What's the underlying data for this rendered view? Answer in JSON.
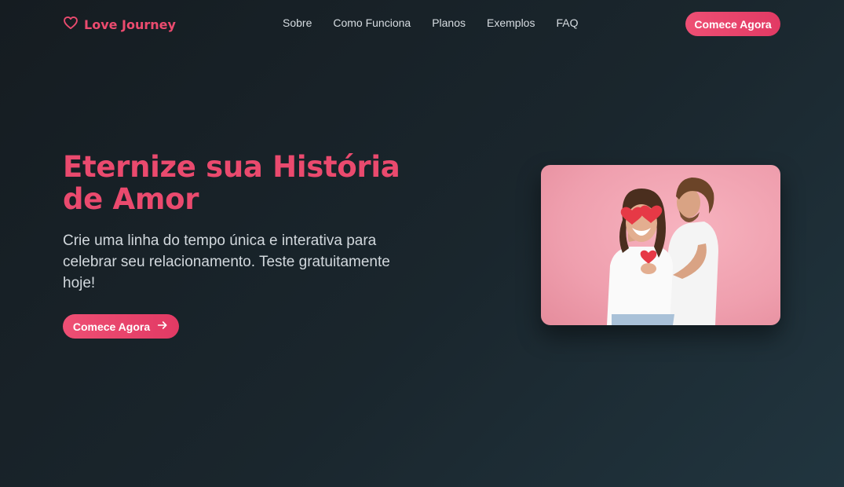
{
  "brand": {
    "name": "Love Journey",
    "icon": "heart-outline-icon",
    "color": "#ec4b6f"
  },
  "nav": {
    "links": [
      "Sobre",
      "Como Funciona",
      "Planos",
      "Exemplos",
      "FAQ"
    ],
    "cta_label": "Comece Agora"
  },
  "hero": {
    "title": "Eternize sua História de Amor",
    "subtitle": "Crie uma linha do tempo única e interativa para celebrar seu relacionamento. Teste gratuitamente hoje!",
    "cta_label": "Comece Agora",
    "cta_icon": "arrow-right-icon",
    "image": "couple-with-heart-cutouts-photo"
  },
  "colors": {
    "accent": "#ec4b6f",
    "background": "#1a262d",
    "photo_background": "#f2a6b3"
  }
}
